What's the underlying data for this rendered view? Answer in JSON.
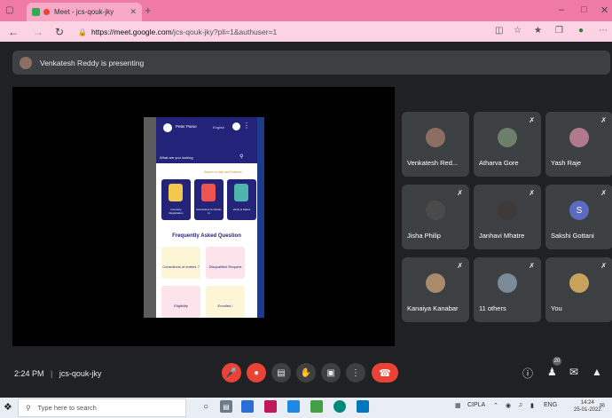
{
  "browser": {
    "tab_title": "Meet - jcs-qouk-jky",
    "url_host": "https://meet.google.com",
    "url_path": "/jcs-qouk-jky?pli=1&authuser=1"
  },
  "presenting": {
    "text": "Venkatesh Reddy is presenting"
  },
  "shared_app": {
    "title": "Peter Parse",
    "lang": "English",
    "search": "What are you looking",
    "help": "Search in help and features",
    "tiles": [
      "Inventory Registration",
      "Instructions to Check-In",
      "Verify & Status"
    ],
    "faq": "Frequently Asked Question",
    "cards": [
      "Corrections of entries ?",
      "Disqualified Request",
      "Eligibility",
      "Enrolled /"
    ]
  },
  "participants": [
    {
      "name": "Venkatesh Red...",
      "muted": false,
      "avatar_color": "#8d6e63"
    },
    {
      "name": "Atharva Gore",
      "muted": true,
      "avatar_color": "#6d7f6a"
    },
    {
      "name": "Yash Raje",
      "muted": true,
      "avatar_color": "#b07a8c"
    },
    {
      "name": "Jisha Philip",
      "muted": true,
      "avatar_color": "#4a4a4a"
    },
    {
      "name": "Janhavi Mhatre",
      "muted": true,
      "avatar_color": "#3f3a3a"
    },
    {
      "name": "Sakshi Gottani",
      "muted": true,
      "avatar_color": "#5b6bc0",
      "initial": "S"
    },
    {
      "name": "Kanaiya Kanabar",
      "muted": true,
      "avatar_color": "#a98a6a"
    },
    {
      "name": "11 others",
      "muted": true,
      "avatar_color": "#7a8a96"
    },
    {
      "name": "You",
      "muted": true,
      "avatar_color": "#c9a25b"
    }
  ],
  "meeting": {
    "time": "2:24 PM",
    "separator": "|",
    "code": "jcs-qouk-jky",
    "participant_count": "20"
  },
  "taskbar": {
    "search_placeholder": "Type here to search",
    "weather": "CIPLA",
    "lang": "ENG",
    "time": "14:24",
    "date": "25-01-2022"
  },
  "colors": {
    "end_call": "#ea4335",
    "panel": "#3c4043",
    "background": "#202124"
  }
}
